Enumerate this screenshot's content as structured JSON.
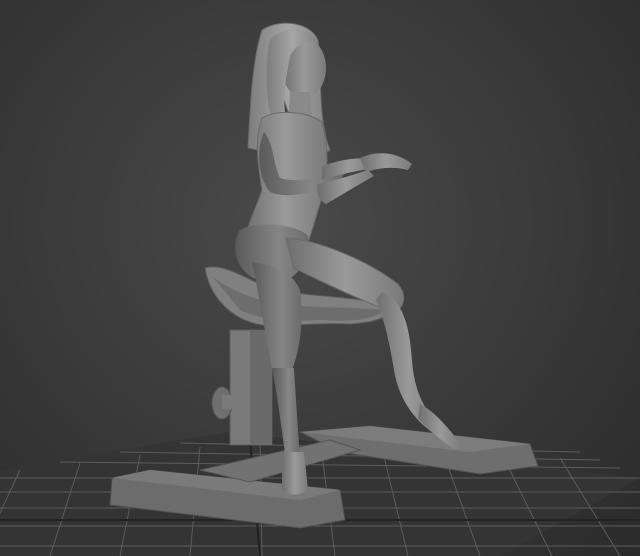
{
  "viewport": {
    "shading": "clay-gray",
    "background_color": "#3a3a3a",
    "grid_color": "#5a5a5a",
    "model_color": "#8e8e8e"
  },
  "scene": {
    "objects": [
      "seated-female-figure",
      "saddle-stool",
      "stool-base",
      "ground-grid"
    ]
  }
}
